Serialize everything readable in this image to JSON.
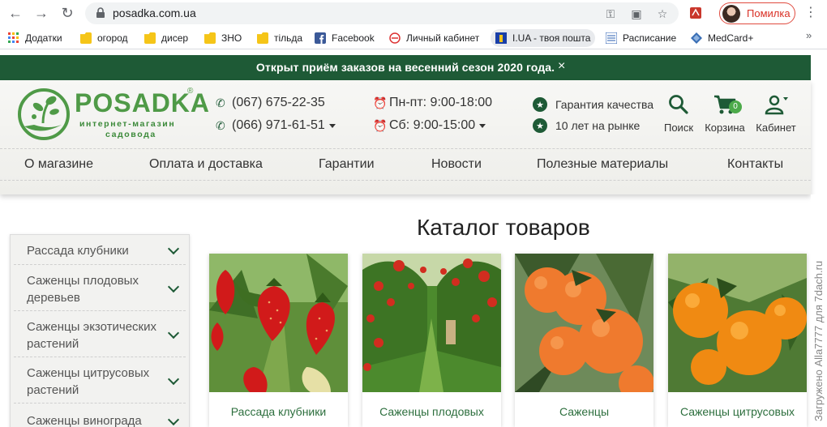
{
  "browser": {
    "url": "posadka.com.ua",
    "profile_name": "Помилка",
    "bookmarks": [
      {
        "label": "Додатки",
        "icon": "apps-grid-icon"
      },
      {
        "label": "огород",
        "icon": "folder-icon"
      },
      {
        "label": "дисер",
        "icon": "folder-icon"
      },
      {
        "label": "ЗНО",
        "icon": "folder-icon"
      },
      {
        "label": "тільда",
        "icon": "folder-icon"
      },
      {
        "label": "Facebook",
        "icon": "facebook-icon"
      },
      {
        "label": "Личный кабинет",
        "icon": "cabinet-icon"
      },
      {
        "label": "I.UA - твоя пошта",
        "icon": "iua-icon"
      },
      {
        "label": "Расписание",
        "icon": "schedule-icon"
      },
      {
        "label": "MedCard+",
        "icon": "medcard-icon"
      }
    ],
    "more": "»"
  },
  "notice": {
    "text": "Открыт приём заказов на весенний сезон 2020 года.",
    "close": "×"
  },
  "logo": {
    "name": "POSADKA",
    "reg": "®",
    "sub1": "интернет-магазин",
    "sub2": "садовода"
  },
  "contacts": {
    "phone1": "(067) 675-22-35",
    "phone2": "(066) 971-61-51",
    "hours1": "Пн-пт: 9:00-18:00",
    "hours2": "Сб: 9:00-15:00"
  },
  "promises": {
    "quality": "Гарантия качества",
    "years": "10 лет на рынке"
  },
  "actions": {
    "search": "Поиск",
    "cart": "Корзина",
    "cart_count": "0",
    "cabinet": "Кабинет"
  },
  "nav": [
    "О магазине",
    "Оплата и доставка",
    "Гарантии",
    "Новости",
    "Полезные материалы",
    "Контакты"
  ],
  "catalog_title": "Каталог товаров",
  "sidebar": [
    "Рассада клубники",
    "Саженцы плодовых деревьев",
    "Саженцы экзотических растений",
    "Саженцы цитрусовых растений",
    "Саженцы винограда"
  ],
  "cards": [
    "Рассада клубники",
    "Саженцы плодовых",
    "Саженцы",
    "Саженцы цитрусовых"
  ],
  "watermark": "Загружено Alla7777 для 7dach.ru",
  "colors": {
    "brand_green": "#1e5a36",
    "logo_green": "#4f9a47",
    "badge_green": "#4caa4a"
  }
}
